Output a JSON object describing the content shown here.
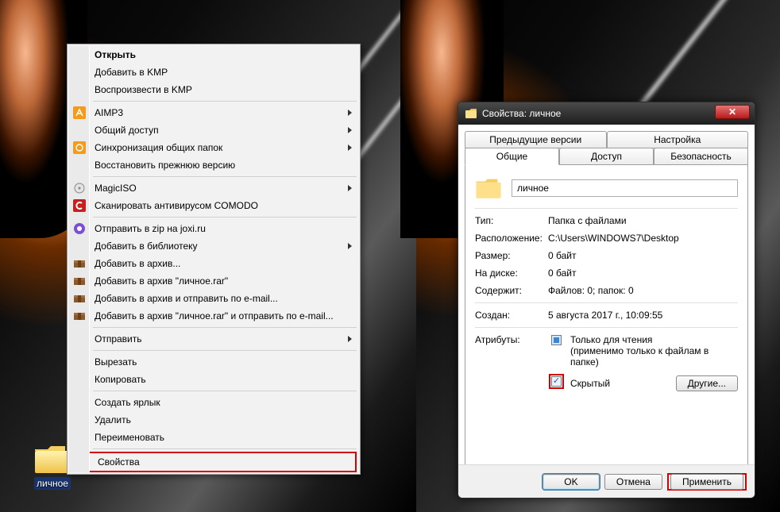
{
  "desktop": {
    "folder_label": "личное"
  },
  "context_menu": {
    "open": "Открыть",
    "add_kmp": "Добавить в KMP",
    "play_kmp": "Воспроизвести в KMP",
    "aimp3": "AIMP3",
    "shared_access": "Общий доступ",
    "sync_shared": "Синхронизация общих папок",
    "restore_prev": "Восстановить прежнюю версию",
    "magiciso": "MagicISO",
    "scan_comodo": "Сканировать антивирусом COMODO",
    "zip_joxi": "Отправить в zip на joxi.ru",
    "add_library": "Добавить в библиотеку",
    "rar_add": "Добавить в архив...",
    "rar_add_name": "Добавить в архив \"личное.rar\"",
    "rar_email": "Добавить в архив и отправить по e-mail...",
    "rar_name_email": "Добавить в архив \"личное.rar\" и отправить по e-mail...",
    "send_to": "Отправить",
    "cut": "Вырезать",
    "copy": "Копировать",
    "shortcut": "Создать ярлык",
    "delete": "Удалить",
    "rename": "Переименовать",
    "properties": "Свойства"
  },
  "dialog": {
    "title": "Свойства: личное",
    "tabs": {
      "prev_versions": "Предыдущие версии",
      "customize": "Настройка",
      "general": "Общие",
      "sharing": "Доступ",
      "security": "Безопасность"
    },
    "name_value": "личное",
    "labels": {
      "type": "Тип:",
      "location": "Расположение:",
      "size": "Размер:",
      "size_on_disk": "На диске:",
      "contains": "Содержит:",
      "created": "Создан:",
      "attributes": "Атрибуты:",
      "readonly": "Только для чтения",
      "readonly_note": "(применимо только к файлам в папке)",
      "hidden": "Скрытый",
      "other_btn": "Другие..."
    },
    "values": {
      "type": "Папка с файлами",
      "location": "C:\\Users\\WINDOWS7\\Desktop",
      "size": "0 байт",
      "size_on_disk": "0 байт",
      "contains": "Файлов: 0; папок: 0",
      "created": "5 августа 2017 г., 10:09:55"
    },
    "buttons": {
      "ok": "OK",
      "cancel": "Отмена",
      "apply": "Применить"
    }
  }
}
